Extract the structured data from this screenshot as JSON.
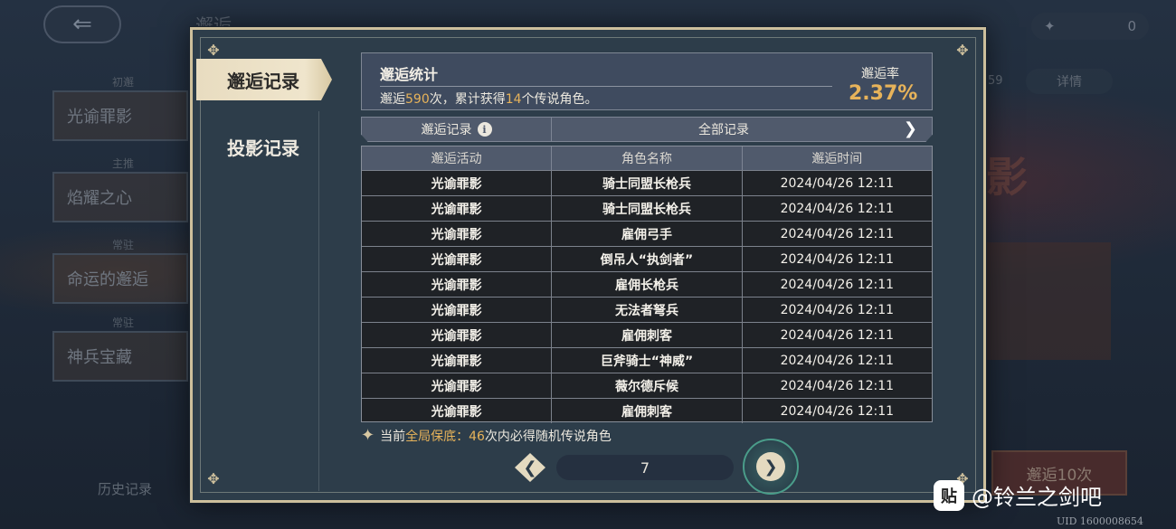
{
  "background": {
    "back_icon": "back-arrow-icon",
    "title": "邂逅",
    "currency_value": "0",
    "search_label": "详情",
    "side_items": [
      {
        "tag": "初邂",
        "label": "光谕罪影"
      },
      {
        "tag": "主推",
        "label": "焰耀之心"
      },
      {
        "tag": "常驻",
        "label": "命运的邂逅"
      },
      {
        "tag": "常驻",
        "label": "神兵宝藏"
      }
    ],
    "history_label": "历史记录",
    "right_button": "邂逅10次",
    "big_text": "影",
    "small_number": "59"
  },
  "tabs": {
    "active": "邂逅记录",
    "inactive": "投影记录"
  },
  "stats": {
    "title": "邂逅统计",
    "prefix": "邂逅",
    "count": "590",
    "middle": "次，累计获得",
    "legend_count": "14",
    "suffix": "个传说角色。",
    "rate_label": "邂逅率",
    "rate_value": "2.37%"
  },
  "filter": {
    "label": "邂逅记录",
    "info_icon": "i",
    "value": "全部记录",
    "arrow": "❯"
  },
  "table": {
    "headers": [
      "邂逅活动",
      "角色名称",
      "邂逅时间"
    ],
    "rows": [
      [
        "光谕罪影",
        "骑士同盟长枪兵",
        "2024/04/26 12:11"
      ],
      [
        "光谕罪影",
        "骑士同盟长枪兵",
        "2024/04/26 12:11"
      ],
      [
        "光谕罪影",
        "雇佣弓手",
        "2024/04/26 12:11"
      ],
      [
        "光谕罪影",
        "倒吊人“执剑者”",
        "2024/04/26 12:11"
      ],
      [
        "光谕罪影",
        "雇佣长枪兵",
        "2024/04/26 12:11"
      ],
      [
        "光谕罪影",
        "无法者弩兵",
        "2024/04/26 12:11"
      ],
      [
        "光谕罪影",
        "雇佣刺客",
        "2024/04/26 12:11"
      ],
      [
        "光谕罪影",
        "巨斧骑士“神威”",
        "2024/04/26 12:11"
      ],
      [
        "光谕罪影",
        "薇尔德斥候",
        "2024/04/26 12:11"
      ],
      [
        "光谕罪影",
        "雇佣刺客",
        "2024/04/26 12:11"
      ]
    ]
  },
  "note": {
    "prefix": "当前",
    "highlight": "全局保底：",
    "count": "46",
    "suffix": "次内必得随机传说角色"
  },
  "pager": {
    "prev": "❮",
    "page": "7",
    "next": "❯"
  },
  "watermark": {
    "logo": "贴",
    "text": "@铃兰之剑吧",
    "uid": "UID 1600008654"
  },
  "colors": {
    "accent": "#e7b35a",
    "frame": "#cdbf9c",
    "panel": "#2d3d4a",
    "table_bg": "#1f2226"
  }
}
